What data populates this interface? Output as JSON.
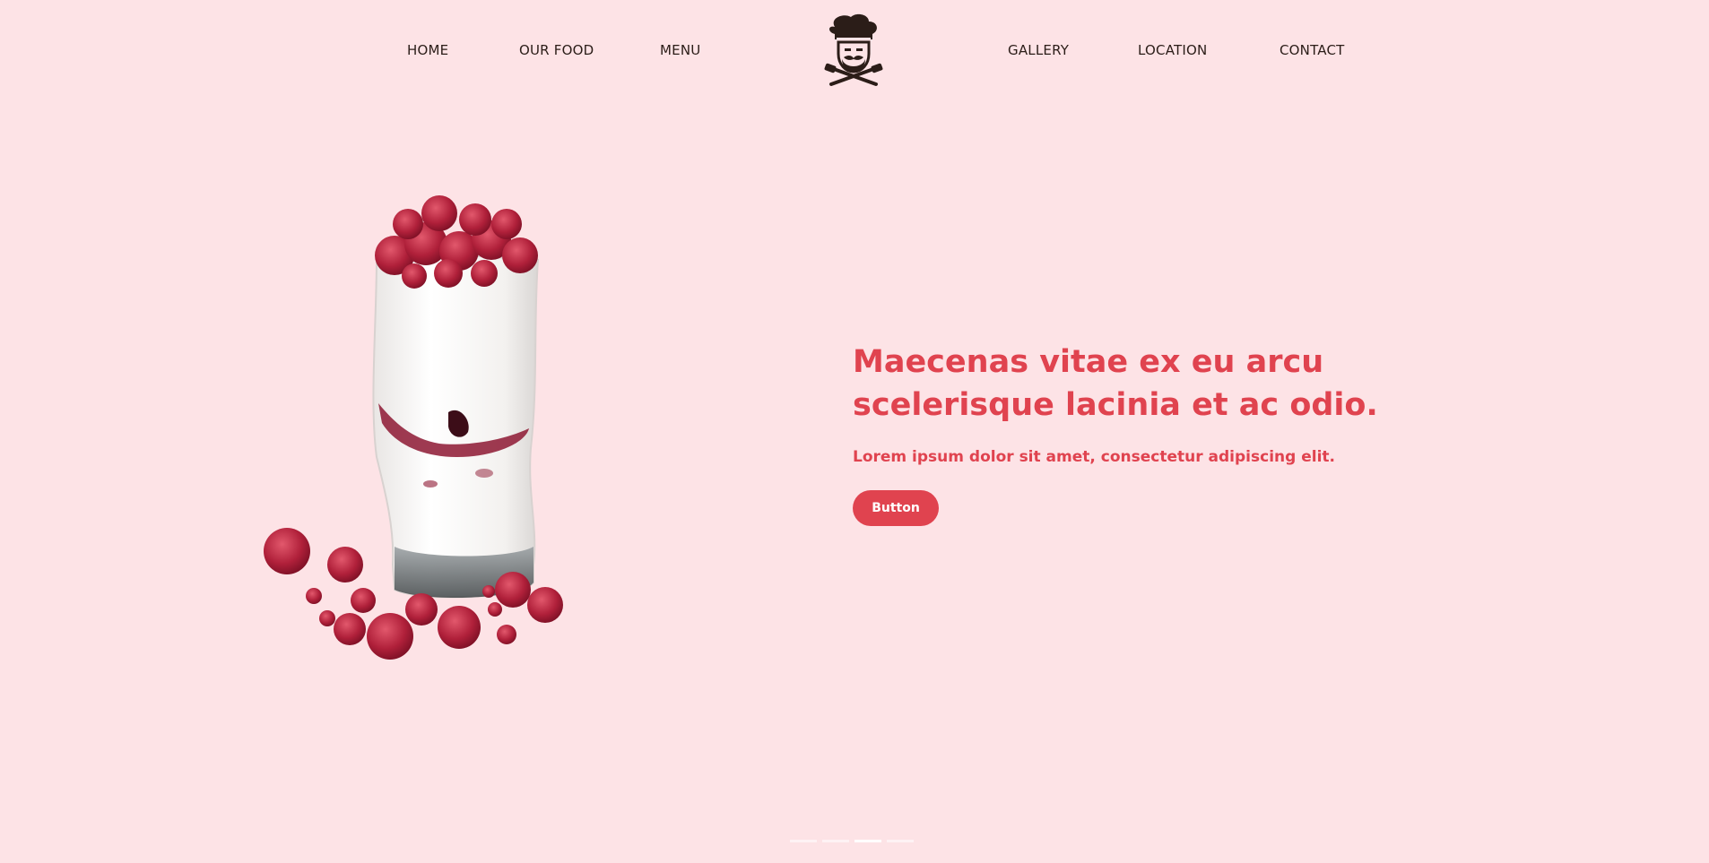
{
  "nav": {
    "left_links": [
      {
        "label": "HOME"
      },
      {
        "label": "OUR FOOD"
      },
      {
        "label": "MENU"
      }
    ],
    "right_links": [
      {
        "label": "GALLERY"
      },
      {
        "label": "LOCATION"
      },
      {
        "label": "CONTACT"
      }
    ],
    "logo_icon": "chef-logo-icon"
  },
  "hero": {
    "title": "Maecenas vitae ex eu arcu scelerisque lacinia et ac odio.",
    "subtitle": "Lorem ipsum dolor sit amet, consectetur adipiscing elit.",
    "button_label": "Button",
    "image_icon": "raspberry-milkshake-image"
  },
  "slider": {
    "slide_count": 4,
    "active_index": 2
  },
  "colors": {
    "background": "#fde3e6",
    "accent": "#e0434f",
    "nav_text": "#2b1d18"
  }
}
